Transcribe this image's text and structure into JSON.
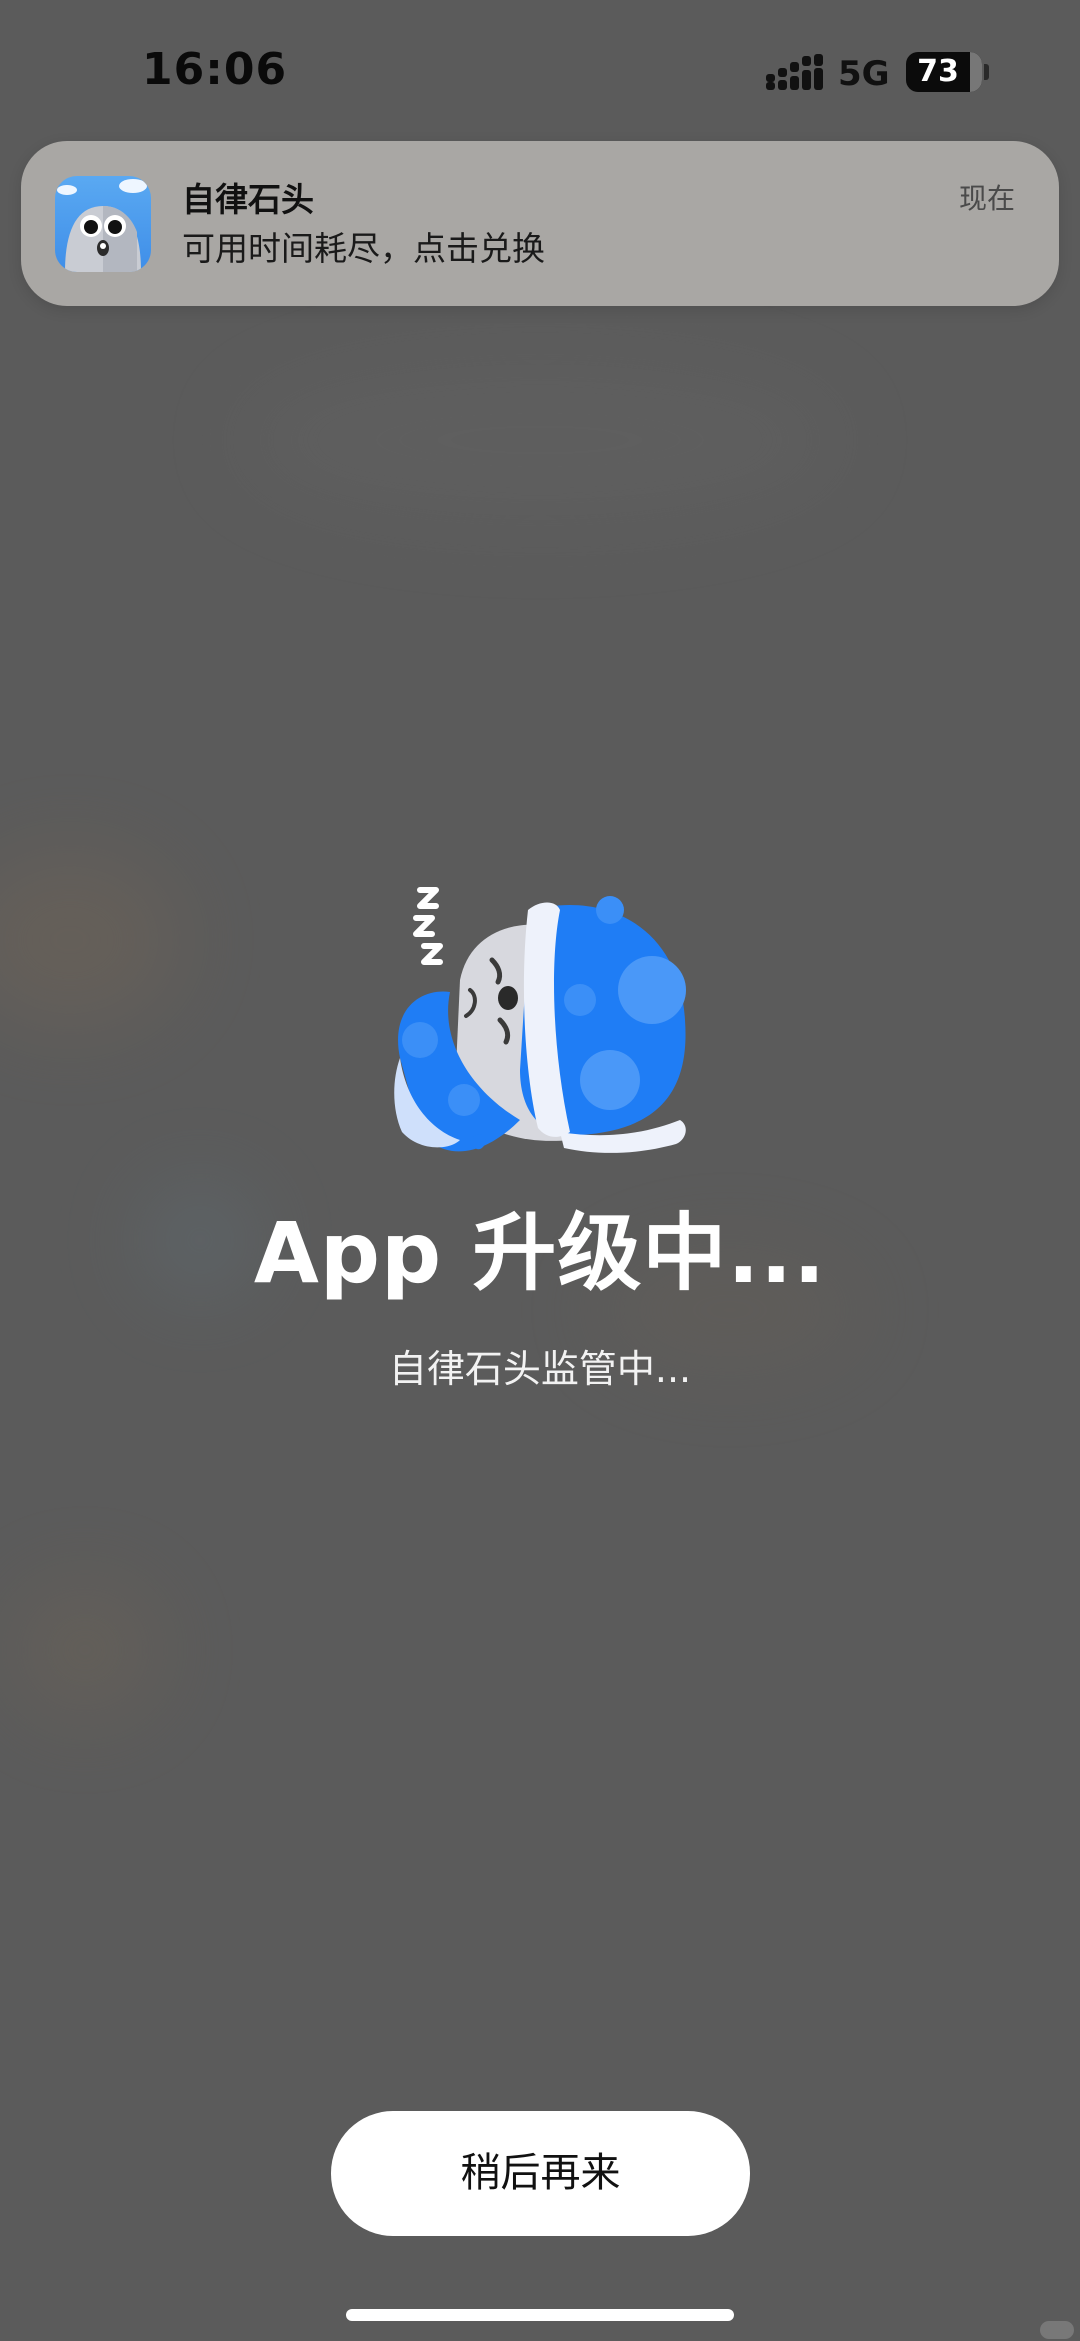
{
  "status_bar": {
    "time": "16:06",
    "network": "5G",
    "battery": "73",
    "signal_icon": "cellular-signal-icon"
  },
  "notification": {
    "app_name": "自律石头",
    "message": "可用时间耗尽，点击兑换",
    "time": "现在",
    "icon": "app-stone-icon"
  },
  "main": {
    "title": "App 升级中...",
    "subtitle": "自律石头监管中...",
    "illustration": "sleeping-stone-icon"
  },
  "actions": {
    "later_label": "稍后再来"
  },
  "colors": {
    "background": "#5b5b5b",
    "notification_bg": "#a9a7a4",
    "mascot_blue": "#1f7df5",
    "button_bg": "#ffffff"
  }
}
